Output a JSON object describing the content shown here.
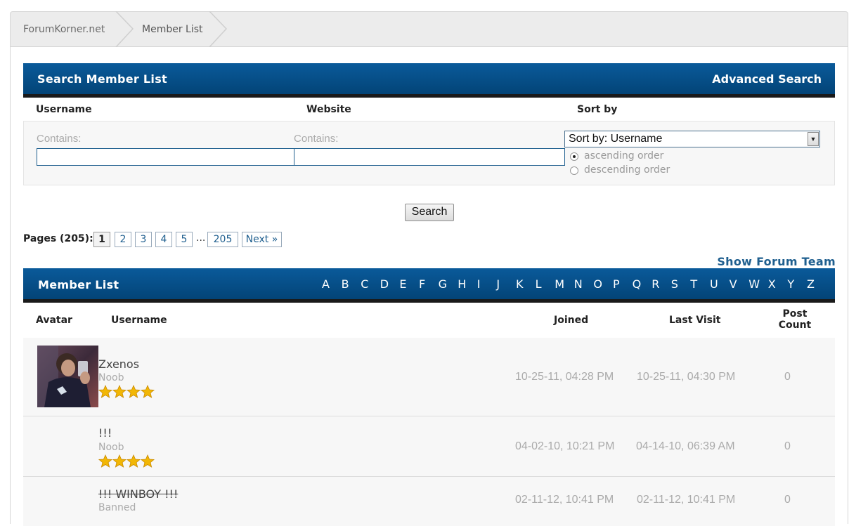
{
  "breadcrumb": {
    "items": [
      "ForumKorner.net",
      "Member List"
    ]
  },
  "search": {
    "title": "Search Member List",
    "advanced_link": "Advanced Search",
    "labels": {
      "username": "Username",
      "website": "Website",
      "sort_by": "Sort by"
    },
    "contains_label": "Contains:",
    "username_value": "",
    "website_value": "",
    "sort_select": "Sort by: Username",
    "order_options": [
      "ascending order",
      "descending order"
    ],
    "order_selected": "ascending order",
    "button": "Search"
  },
  "pagination": {
    "label": "Pages (205):",
    "pages": [
      "1",
      "2",
      "3",
      "4",
      "5"
    ],
    "current": "1",
    "ellipsis": "...",
    "last": "205",
    "next": "Next »"
  },
  "show_team_link": "Show Forum Team",
  "member_list": {
    "title": "Member List",
    "letters": [
      "A",
      "B",
      "C",
      "D",
      "E",
      "F",
      "G",
      "H",
      "I",
      "J",
      "K",
      "L",
      "M",
      "N",
      "O",
      "P",
      "Q",
      "R",
      "S",
      "T",
      "U",
      "V",
      "W",
      "X",
      "Y",
      "Z"
    ],
    "columns": {
      "avatar": "Avatar",
      "username": "Username",
      "joined": "Joined",
      "last_visit": "Last Visit",
      "post_count_1": "Post",
      "post_count_2": "Count"
    },
    "rows": [
      {
        "username": "Zxenos",
        "role": "Noob",
        "stars": 4,
        "joined": "10-25-11, 04:28 PM",
        "last_visit": "10-25-11, 04:30 PM",
        "posts": "0"
      },
      {
        "username": "!!!",
        "role": "Noob",
        "stars": 4,
        "joined": "04-02-10, 10:21 PM",
        "last_visit": "04-14-10, 06:39 AM",
        "posts": "0"
      },
      {
        "username": "!!! WINBOY !!!",
        "role": "Banned",
        "stars": 0,
        "joined": "02-11-12, 10:41 PM",
        "last_visit": "02-11-12, 10:41 PM",
        "posts": "0"
      }
    ]
  },
  "colors": {
    "header_blue": "#034477",
    "link_blue": "#1f5f8f",
    "star_gold": "#f2b705"
  }
}
